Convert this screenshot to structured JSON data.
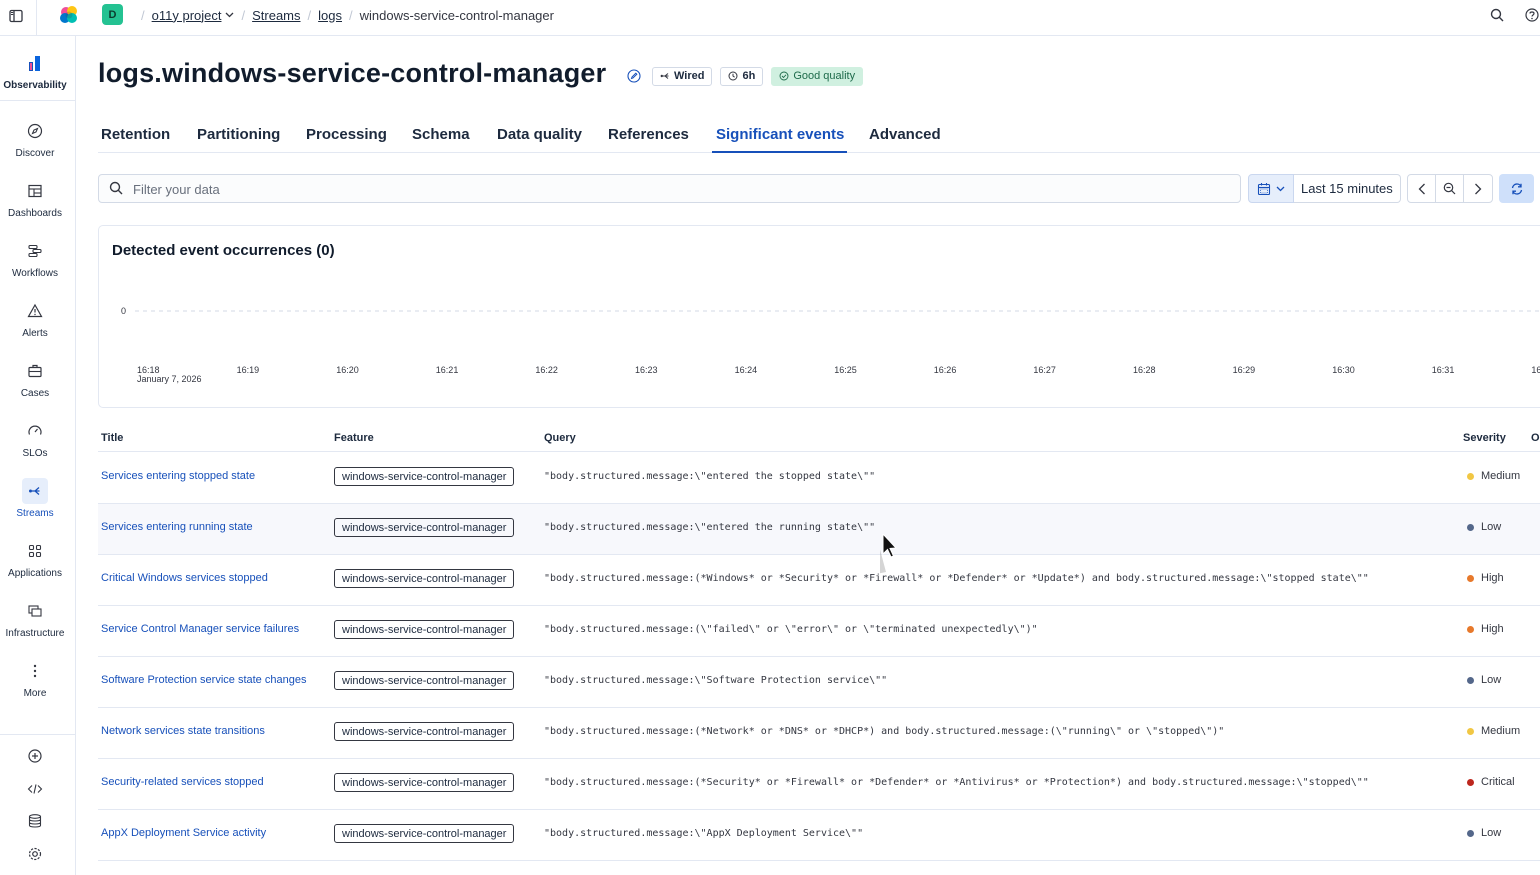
{
  "topbar": {
    "project_initial": "D",
    "breadcrumbs": [
      "o11y project",
      "Streams",
      "logs",
      "windows-service-control-manager"
    ]
  },
  "sidebar": {
    "items": [
      {
        "label": "Observability",
        "icon": "observability-icon"
      },
      {
        "label": "Discover",
        "icon": "compass-icon"
      },
      {
        "label": "Dashboards",
        "icon": "dashboard-icon"
      },
      {
        "label": "Workflows",
        "icon": "workflow-icon"
      },
      {
        "label": "Alerts",
        "icon": "warning-icon"
      },
      {
        "label": "Cases",
        "icon": "briefcase-icon"
      },
      {
        "label": "SLOs",
        "icon": "gauge-icon"
      },
      {
        "label": "Streams",
        "icon": "streams-icon"
      },
      {
        "label": "Applications",
        "icon": "grid-icon"
      },
      {
        "label": "Infrastructure",
        "icon": "infrastructure-icon"
      },
      {
        "label": "More",
        "icon": "more-icon"
      }
    ],
    "active": "Streams"
  },
  "page": {
    "title": "logs.windows-service-control-manager",
    "badges": {
      "wired": "Wired",
      "retention": "6h",
      "quality": "Good quality"
    }
  },
  "tabs": [
    "Retention",
    "Partitioning",
    "Processing",
    "Schema",
    "Data quality",
    "References",
    "Significant events",
    "Advanced"
  ],
  "active_tab": "Significant events",
  "search": {
    "placeholder": "Filter your data",
    "value": ""
  },
  "date_picker": {
    "range_label": "Last 15 minutes"
  },
  "chart_data": {
    "type": "bar",
    "title": "Detected event occurrences (0)",
    "y_tick": "0",
    "x_ticks": [
      "16:18",
      "16:19",
      "16:20",
      "16:21",
      "16:22",
      "16:23",
      "16:24",
      "16:25",
      "16:26",
      "16:27",
      "16:28",
      "16:29",
      "16:30",
      "16:31",
      "16"
    ],
    "x_date_label": "January 7, 2026",
    "values": []
  },
  "table": {
    "headers": {
      "title": "Title",
      "feature": "Feature",
      "query": "Query",
      "severity": "Severity",
      "extra": "O"
    },
    "rows": [
      {
        "title": "Services entering stopped state",
        "feature": "windows-service-control-manager",
        "query": "\"body.structured.message:\\\"entered the stopped state\\\"\"",
        "severity": "Medium",
        "color": "#f1c744"
      },
      {
        "title": "Services entering running state",
        "feature": "windows-service-control-manager",
        "query": "\"body.structured.message:\\\"entered the running state\\\"\"",
        "severity": "Low",
        "color": "#54678a"
      },
      {
        "title": "Critical Windows services stopped",
        "feature": "windows-service-control-manager",
        "query": "\"body.structured.message:(*Windows* or *Security* or *Firewall* or *Defender* or *Update*) and body.structured.message:\\\"stopped state\\\"\"",
        "severity": "High",
        "color": "#e7792b"
      },
      {
        "title": "Service Control Manager service failures",
        "feature": "windows-service-control-manager",
        "query": "\"body.structured.message:(\\\"failed\\\" or \\\"error\\\" or \\\"terminated unexpectedly\\\")\"",
        "severity": "High",
        "color": "#e7792b"
      },
      {
        "title": "Software Protection service state changes",
        "feature": "windows-service-control-manager",
        "query": "\"body.structured.message:\\\"Software Protection service\\\"\"",
        "severity": "Low",
        "color": "#54678a"
      },
      {
        "title": "Network services state transitions",
        "feature": "windows-service-control-manager",
        "query": "\"body.structured.message:(*Network* or *DNS* or *DHCP*) and body.structured.message:(\\\"running\\\" or \\\"stopped\\\")\"",
        "severity": "Medium",
        "color": "#f1c744"
      },
      {
        "title": "Security-related services stopped",
        "feature": "windows-service-control-manager",
        "query": "\"body.structured.message:(*Security* or *Firewall* or *Defender* or *Antivirus* or *Protection*) and body.structured.message:\\\"stopped\\\"\"",
        "severity": "Critical",
        "color": "#bd271e"
      },
      {
        "title": "AppX Deployment Service activity",
        "feature": "windows-service-control-manager",
        "query": "\"body.structured.message:\\\"AppX Deployment Service\\\"\"",
        "severity": "Low",
        "color": "#54678a"
      }
    ]
  }
}
